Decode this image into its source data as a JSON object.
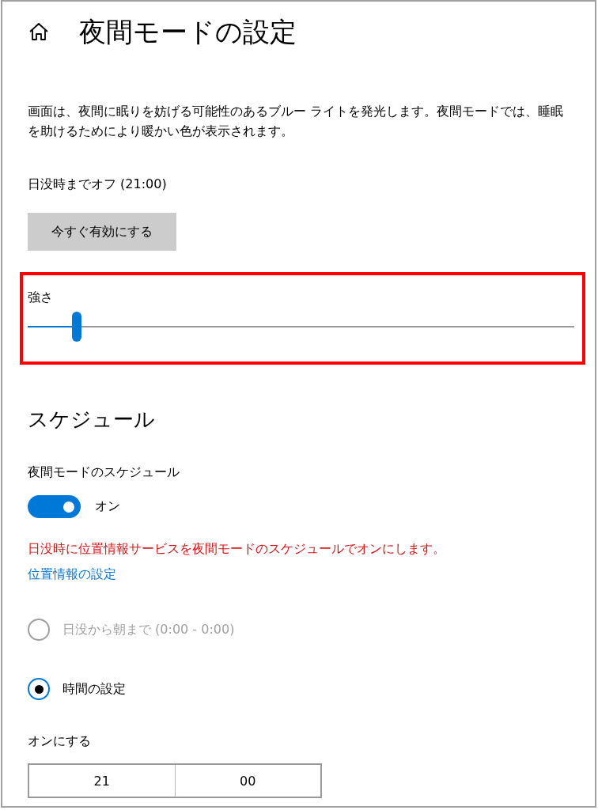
{
  "page": {
    "title": "夜間モードの設定"
  },
  "description": "画面は、夜間に眠りを妨げる可能性のあるブルー ライトを発光します。夜間モードでは、睡眠を助けるためにより暖かい色が表示されます。",
  "status": "日没時までオフ (21:00)",
  "enable_button": {
    "label": "今すぐ有効にする"
  },
  "strength": {
    "label": "強さ",
    "level": 0.09,
    "highlighted": true
  },
  "schedule": {
    "heading": "スケジュール",
    "toggle": {
      "label": "夜間モードのスケジュール",
      "on": true,
      "state_text": "オン"
    },
    "warning": "日没時に位置情報サービスを夜間モードのスケジュールでオンにします。",
    "link": "位置情報の設定",
    "options": [
      {
        "label": "日没から朝まで (0:00 - 0:00)",
        "selected": false,
        "disabled": true
      },
      {
        "label": "時間の設定",
        "selected": true,
        "disabled": false
      }
    ],
    "turn_on": {
      "label": "オンにする",
      "hour": "21",
      "minute": "00"
    }
  }
}
